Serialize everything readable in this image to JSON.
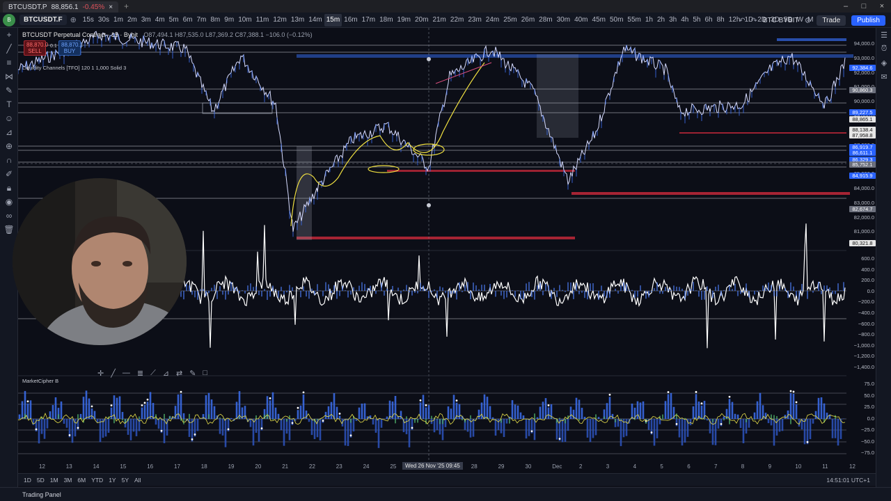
{
  "browser": {
    "tab_title": "BTCUSDT.P",
    "tab_price": "88,856.1",
    "tab_change": "-0.45%",
    "new_tab": "+"
  },
  "toolbar": {
    "symbol": "BTCUSDT.F",
    "intervals": [
      "15s",
      "30s",
      "1m",
      "2m",
      "3m",
      "4m",
      "5m",
      "6m",
      "7m",
      "8m",
      "9m",
      "10m",
      "11m",
      "12m",
      "13m",
      "14m",
      "15m",
      "16m",
      "17m",
      "18m",
      "19m",
      "20m",
      "21m",
      "22m",
      "23m",
      "24m",
      "25m",
      "26m",
      "28m",
      "30m",
      "40m",
      "45m",
      "50m",
      "55m",
      "1h",
      "2h",
      "3h",
      "4h",
      "5h",
      "6h",
      "8h",
      "12h",
      "1D",
      "2D",
      "3D",
      "5D",
      "W",
      "M"
    ],
    "active_interval": "15m",
    "broker": "BTC BYBIT",
    "trade_label": "Trade",
    "publish_label": "Publish"
  },
  "legend": {
    "symbol_line": "BTCUSDT Perpetual Contract · 15 · Bybit",
    "ohlc": "O87,494.1 H87,535.0 L87,369.2 C87,388.1 −106.0 (−0.12%)",
    "sell_price": "88,870.0",
    "sell_label": "SELL",
    "spread": "0.1",
    "buy_price": "88,870.1",
    "buy_label": "BUY",
    "indicator1": "Liquidity Channels [TFO] 120 1 1,000 Solid 3",
    "indicator2": "MarketCipher B"
  },
  "price_axis": {
    "labels": [
      "94,000.0",
      "93,000.0",
      "92,000.0",
      "91,000.0",
      "90,000.0",
      "89,000.0",
      "88,000.0",
      "87,000.0",
      "86,000.0",
      "85,000.0",
      "84,000.0",
      "83,000.0",
      "82,000.0",
      "81,000.0"
    ],
    "tags": [
      {
        "text": "92,384.6",
        "color": "#2962ff"
      },
      {
        "text": "90,860.3",
        "color": "#6b6f7c"
      },
      {
        "text": "89,227.5",
        "color": "#2962ff"
      },
      {
        "text": "88,865.1",
        "color": "#e6e6e6"
      },
      {
        "text": "88,138.4",
        "color": "#e6e6e6"
      },
      {
        "text": "87,958.8",
        "color": "#e6e6e6"
      },
      {
        "text": "86,919.7",
        "color": "#2962ff"
      },
      {
        "text": "86,611.1",
        "color": "#2962ff"
      },
      {
        "text": "86,329.3",
        "color": "#2962ff"
      },
      {
        "text": "85,752.1",
        "color": "#6b6f7c"
      },
      {
        "text": "84,915.9",
        "color": "#2962ff"
      },
      {
        "text": "82,674.7",
        "color": "#6b6f7c"
      },
      {
        "text": "80,321.8",
        "color": "#e6e6e6"
      }
    ]
  },
  "osc_axis": {
    "labels": [
      "600.0",
      "400.0",
      "200.0",
      "0.0",
      "−200.0",
      "−400.0",
      "−600.0",
      "−800.0",
      "−1,000.0",
      "−1,200.0",
      "−1,400.0"
    ]
  },
  "mcb_axis": {
    "labels": [
      "75.0",
      "50.0",
      "25.0",
      "0.0",
      "−25.0",
      "−50.0",
      "−75.0"
    ]
  },
  "time_axis": {
    "labels": [
      "12",
      "13",
      "14",
      "15",
      "16",
      "17",
      "18",
      "19",
      "20",
      "21",
      "22",
      "23",
      "24",
      "25",
      "26",
      "27",
      "28",
      "29",
      "30",
      "Dec",
      "2",
      "3",
      "4",
      "5",
      "6",
      "7",
      "8",
      "9",
      "10",
      "11",
      "12"
    ],
    "cursor": "Wed 26 Nov '25   09:45"
  },
  "range_bar": {
    "ranges": [
      "1D",
      "5D",
      "1M",
      "3M",
      "6M",
      "YTD",
      "1Y",
      "5Y",
      "All"
    ],
    "clock": "14:51:01 UTC+1"
  },
  "trading_panel": {
    "label": "Trading Panel"
  },
  "icons": {
    "left": [
      "crosshair-icon",
      "trendline-icon",
      "fib-icon",
      "pattern-icon",
      "brush-icon",
      "text-icon",
      "emoji-icon",
      "ruler-icon",
      "zoom-icon",
      "magnet-icon",
      "lock-icon",
      "eye-icon",
      "link-icon",
      "trash-icon"
    ],
    "right": [
      "watchlist-icon",
      "alerts-icon",
      "layers-icon",
      "chat-icon"
    ]
  },
  "colors": {
    "bg": "#0c0e17",
    "accent": "#2962ff",
    "red": "#e0525a",
    "yellow": "#f0e040"
  }
}
